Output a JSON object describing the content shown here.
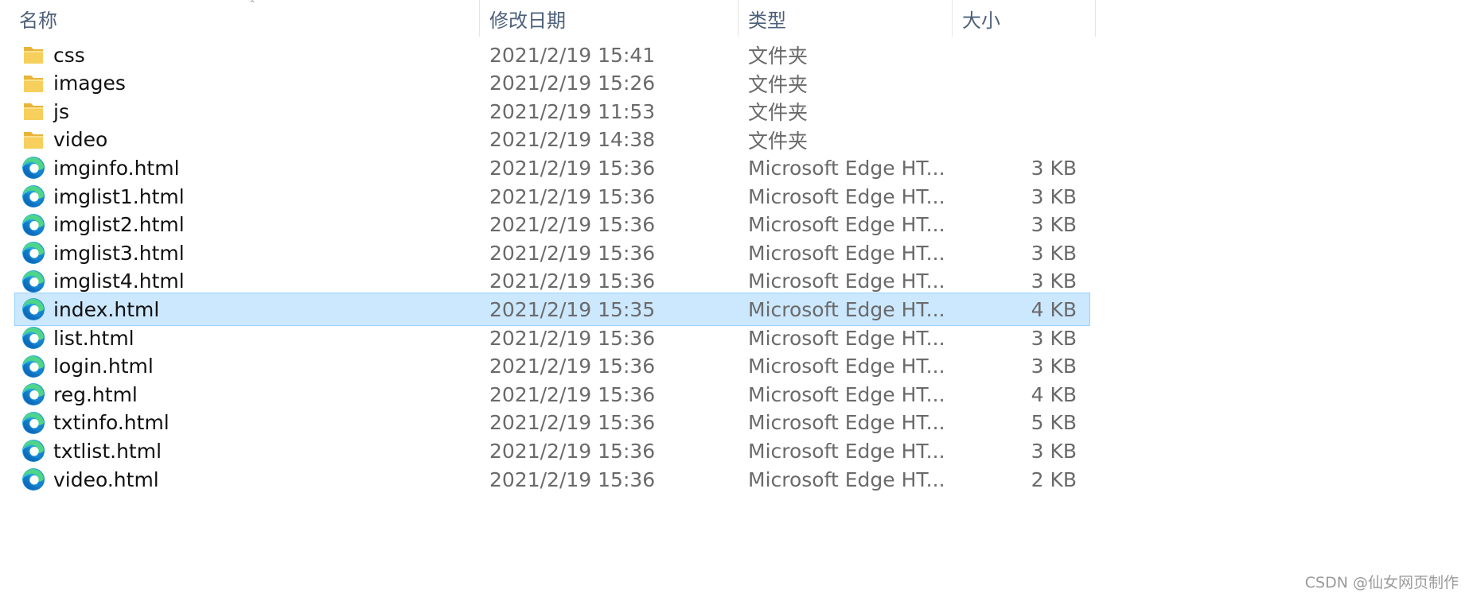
{
  "columns": {
    "name": "名称",
    "date": "修改日期",
    "type": "类型",
    "size": "大小"
  },
  "files": [
    {
      "name": "css",
      "date": "2021/2/19 15:41",
      "type": "文件夹",
      "size": "",
      "icon": "folder-icon",
      "selected": false
    },
    {
      "name": "images",
      "date": "2021/2/19 15:26",
      "type": "文件夹",
      "size": "",
      "icon": "folder-icon",
      "selected": false
    },
    {
      "name": "js",
      "date": "2021/2/19 11:53",
      "type": "文件夹",
      "size": "",
      "icon": "folder-icon",
      "selected": false
    },
    {
      "name": "video",
      "date": "2021/2/19 14:38",
      "type": "文件夹",
      "size": "",
      "icon": "folder-icon",
      "selected": false
    },
    {
      "name": "imginfo.html",
      "date": "2021/2/19 15:36",
      "type": "Microsoft Edge HT...",
      "size": "3 KB",
      "icon": "edge-icon",
      "selected": false
    },
    {
      "name": "imglist1.html",
      "date": "2021/2/19 15:36",
      "type": "Microsoft Edge HT...",
      "size": "3 KB",
      "icon": "edge-icon",
      "selected": false
    },
    {
      "name": "imglist2.html",
      "date": "2021/2/19 15:36",
      "type": "Microsoft Edge HT...",
      "size": "3 KB",
      "icon": "edge-icon",
      "selected": false
    },
    {
      "name": "imglist3.html",
      "date": "2021/2/19 15:36",
      "type": "Microsoft Edge HT...",
      "size": "3 KB",
      "icon": "edge-icon",
      "selected": false
    },
    {
      "name": "imglist4.html",
      "date": "2021/2/19 15:36",
      "type": "Microsoft Edge HT...",
      "size": "3 KB",
      "icon": "edge-icon",
      "selected": false
    },
    {
      "name": "index.html",
      "date": "2021/2/19 15:35",
      "type": "Microsoft Edge HT...",
      "size": "4 KB",
      "icon": "edge-icon",
      "selected": true
    },
    {
      "name": "list.html",
      "date": "2021/2/19 15:36",
      "type": "Microsoft Edge HT...",
      "size": "3 KB",
      "icon": "edge-icon",
      "selected": false
    },
    {
      "name": "login.html",
      "date": "2021/2/19 15:36",
      "type": "Microsoft Edge HT...",
      "size": "3 KB",
      "icon": "edge-icon",
      "selected": false
    },
    {
      "name": "reg.html",
      "date": "2021/2/19 15:36",
      "type": "Microsoft Edge HT...",
      "size": "4 KB",
      "icon": "edge-icon",
      "selected": false
    },
    {
      "name": "txtinfo.html",
      "date": "2021/2/19 15:36",
      "type": "Microsoft Edge HT...",
      "size": "5 KB",
      "icon": "edge-icon",
      "selected": false
    },
    {
      "name": "txtlist.html",
      "date": "2021/2/19 15:36",
      "type": "Microsoft Edge HT...",
      "size": "3 KB",
      "icon": "edge-icon",
      "selected": false
    },
    {
      "name": "video.html",
      "date": "2021/2/19 15:36",
      "type": "Microsoft Edge HT...",
      "size": "2 KB",
      "icon": "edge-icon",
      "selected": false
    }
  ],
  "watermark": "CSDN @仙女网页制作",
  "colors": {
    "selection_bg": "#cce8ff",
    "selection_border": "#99d1ff",
    "header_text": "#4c607a",
    "folder_yellow": "#f7cf5c"
  }
}
